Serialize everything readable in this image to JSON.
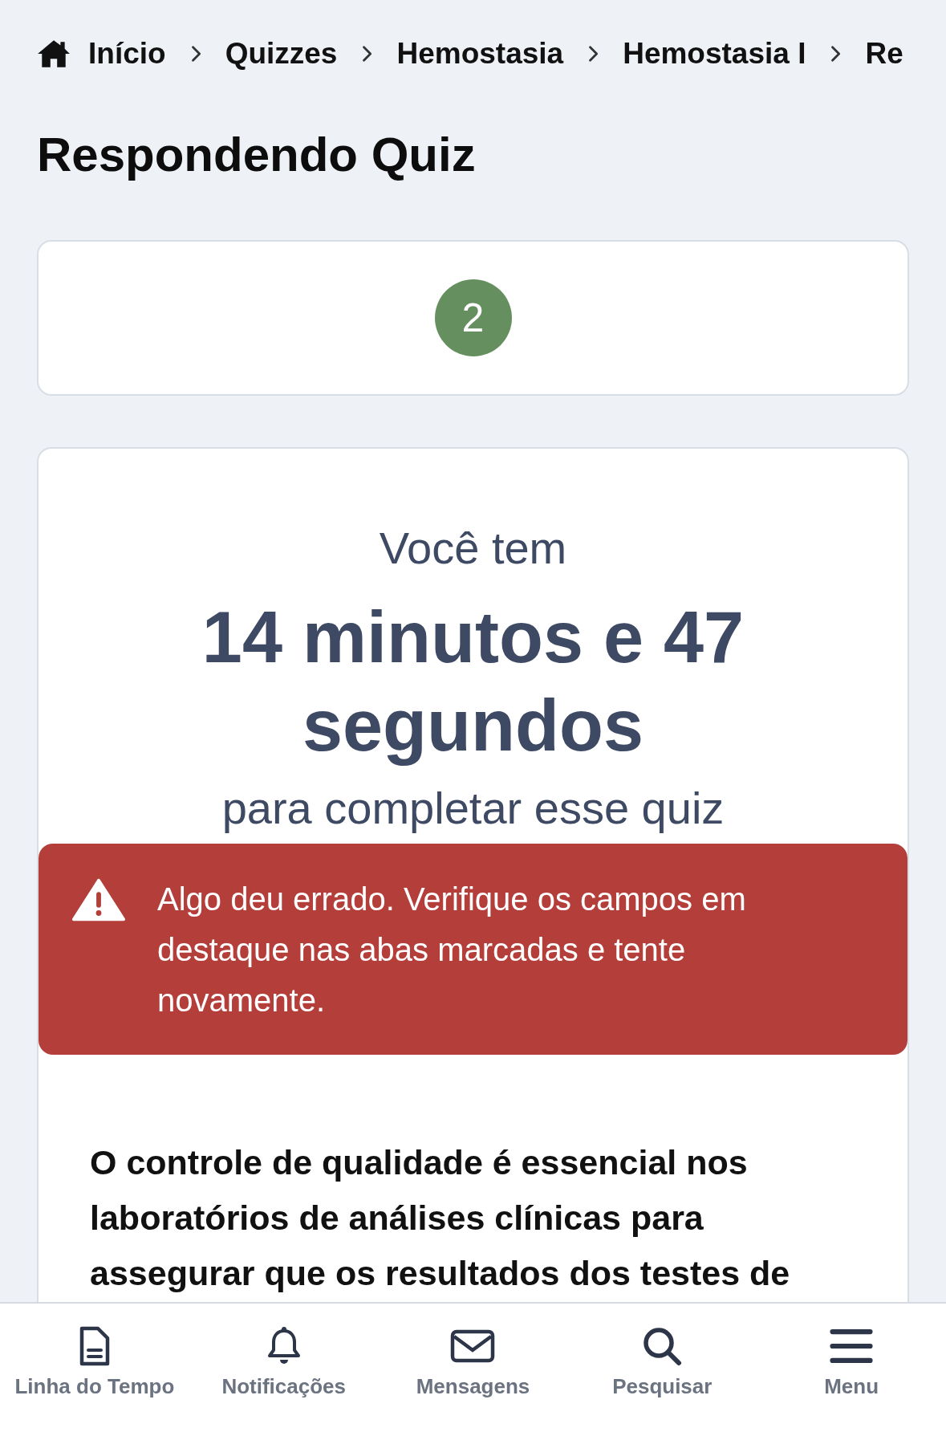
{
  "breadcrumb": [
    {
      "label": "Início",
      "kind": "home"
    },
    {
      "label": "Quizzes",
      "kind": "link"
    },
    {
      "label": "Hemostasia",
      "kind": "link"
    },
    {
      "label": "Hemostasia I",
      "kind": "link"
    },
    {
      "label": "Re",
      "kind": "link"
    }
  ],
  "page_title": "Respondendo Quiz",
  "question_number": "2",
  "timer": {
    "intro": "Você tem",
    "time": "14 minutos e 47 segundos",
    "outro": "para completar esse quiz"
  },
  "alert": {
    "message": "Algo deu errado. Verifique os campos em destaque nas abas marcadas e tente novamente."
  },
  "question": "O controle de qualidade é essencial nos laboratórios de análises clínicas para assegurar que os resultados dos testes de",
  "bottom_nav": [
    {
      "label": "Linha do Tempo",
      "kind": "document"
    },
    {
      "label": "Notificações",
      "kind": "bell"
    },
    {
      "label": "Mensagens",
      "kind": "envelope"
    },
    {
      "label": "Pesquisar",
      "kind": "search"
    },
    {
      "label": "Menu",
      "kind": "menu"
    }
  ]
}
